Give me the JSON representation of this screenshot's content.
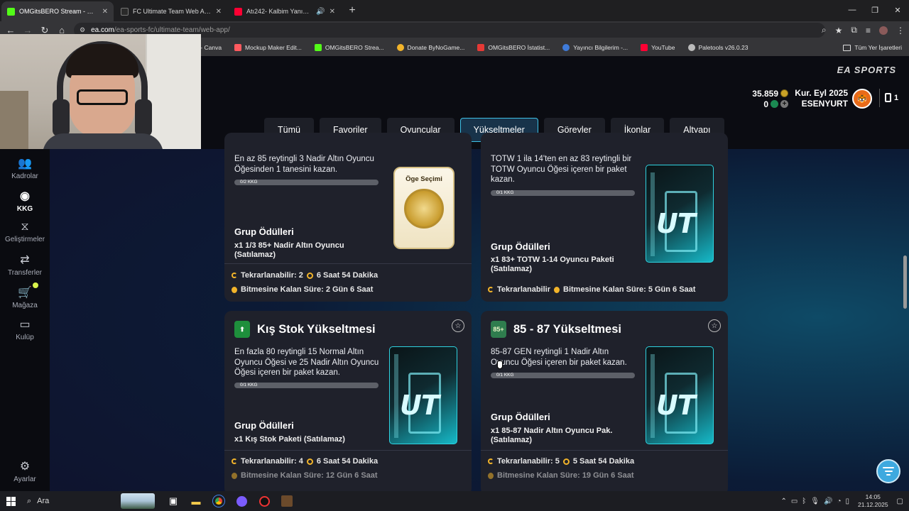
{
  "browser": {
    "tabs": [
      {
        "title": "OMGitsBERO Stream - Watch L",
        "favicon_color": "#53fc18",
        "active": true
      },
      {
        "title": "FC Ultimate Team Web App - E",
        "favicon_color": "#2a2a2a",
        "active": false
      },
      {
        "title": "Atı242- Kalbim Yanımda (O",
        "favicon_color": "#ff0033",
        "active": false
      }
    ],
    "url_domain": "ea.com",
    "url_path": "/ea-sports-fc/ultimate-team/web-app/",
    "bookmarks": [
      {
        "label": "rfa - Canva",
        "favicon_color": "#00c4cc"
      },
      {
        "label": "Mockup Maker Edit...",
        "favicon_color": "#ff5a5f"
      },
      {
        "label": "OMGitsBERO Strea...",
        "favicon_color": "#53fc18"
      },
      {
        "label": "Donate ByNoGame...",
        "favicon_color": "#f2b42a"
      },
      {
        "label": "OMGitsBERO İstatist...",
        "favicon_color": "#e53935"
      },
      {
        "label": "Yayıncı Bilgilerim -...",
        "favicon_color": "#3f7bd9"
      },
      {
        "label": "YouTube",
        "favicon_color": "#ff0033"
      },
      {
        "label": "Paletools v26.0.23",
        "favicon_color": "#bbbbbb"
      }
    ],
    "all_bookmarks_label": "Tüm Yer İşaretleri"
  },
  "header": {
    "brand": "EA SPORTS",
    "coins": "35.859",
    "points": "0",
    "club_line1": "Kur. Eyl 2025",
    "club_line2": "ESENYURT",
    "inventory_count": "1"
  },
  "nav_tabs": [
    "Tümü",
    "Favoriler",
    "Oyuncular",
    "Yükseltmeler",
    "Görevler",
    "İkonlar",
    "Altyapı"
  ],
  "selected_tab": "Yükseltmeler",
  "sidebar": [
    {
      "label": "Kadrolar",
      "icon": "squad-icon"
    },
    {
      "label": "KKG",
      "icon": "sbc-icon",
      "selected": true
    },
    {
      "label": "Geliştirmeler",
      "icon": "evolutions-icon"
    },
    {
      "label": "Transferler",
      "icon": "transfers-icon"
    },
    {
      "label": "Mağaza",
      "icon": "store-icon",
      "notification": true
    },
    {
      "label": "Kulüp",
      "icon": "club-icon"
    },
    {
      "label": "Ayarlar",
      "icon": "settings-icon"
    }
  ],
  "cards": [
    {
      "description": "En az 85 reytingli 3 Nadir Altın Oyuncu Öğesinden 1 tanesini kazan.",
      "progress": "0/2 KKG",
      "group_title": "Grup Ödülleri",
      "reward": "x1 1/3 85+ Nadir Altın Oyuncu (Satılamaz)",
      "repeat": "Tekrarlanabilir: 2",
      "timer": "6 Saat 54 Dakika",
      "remaining": "Bitmesine Kalan Süre: 2 Gün 6 Saat",
      "art_label": "Öge Seçimi"
    },
    {
      "description": "TOTW 1 ila 14'ten en az 83 reytingli bir TOTW Oyuncu Öğesi içeren bir paket kazan.",
      "progress": "0/1 KKG",
      "group_title": "Grup Ödülleri",
      "reward": "x1 83+ TOTW 1-14 Oyuncu Paketi (Satılamaz)",
      "repeat": "Tekrarlanabilir",
      "remaining": "Bitmesine Kalan Süre: 5 Gün 6 Saat",
      "art_label": "UT"
    },
    {
      "title": "Kış Stok Yükseltmesi",
      "description": "En fazla 80 reytingli 15 Normal Altın Oyuncu Öğesi ve 25 Nadir Altın Oyuncu Öğesi içeren bir paket kazan.",
      "progress": "0/1 KKG",
      "group_title": "Grup Ödülleri",
      "reward": "x1 Kış Stok Paketi (Satılamaz)",
      "repeat": "Tekrarlanabilir: 4",
      "timer": "6 Saat 54 Dakika",
      "remaining": "Bitmesine Kalan Süre: 12 Gün 6 Saat",
      "art_label": "UT"
    },
    {
      "title": "85 - 87 Yükseltmesi",
      "title_badge": "85+",
      "description": "85-87 GEN reytingli 1 Nadir Altın Oyuncu Öğesi içeren bir paket kazan.",
      "progress": "0/1 KKG",
      "group_title": "Grup Ödülleri",
      "reward": "x1 85-87 Nadir Altın Oyuncu Pak. (Satılamaz)",
      "repeat": "Tekrarlanabilir: 5",
      "timer": "5 Saat 54 Dakika",
      "remaining": "Bitmesine Kalan Süre: 19 Gün 6 Saat",
      "art_label": "UT"
    }
  ],
  "taskbar": {
    "search_placeholder": "Ara",
    "time": "14:05",
    "date": "21.12.2025"
  }
}
